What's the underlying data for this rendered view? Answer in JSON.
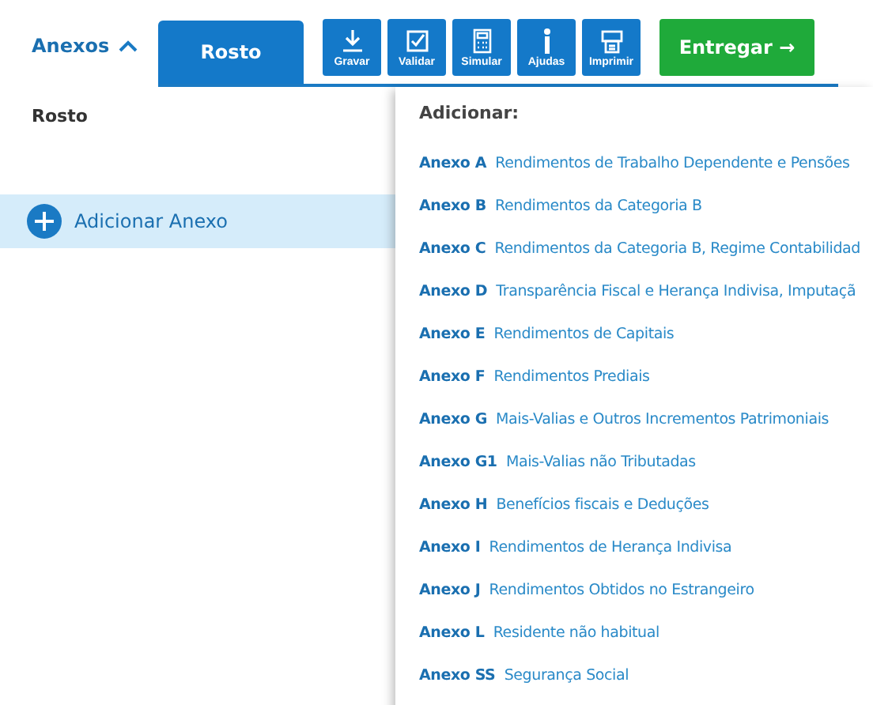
{
  "toolbar": {
    "menu": {
      "label": "Anexos",
      "expanded": true
    },
    "tab": {
      "label": "Rosto",
      "selected": true
    },
    "tools": [
      {
        "kind": "save",
        "label": "Gravar"
      },
      {
        "kind": "validate",
        "label": "Validar"
      },
      {
        "kind": "simulate",
        "label": "Simular"
      },
      {
        "kind": "help",
        "label": "Ajudas"
      },
      {
        "kind": "print",
        "label": "Imprimir"
      }
    ],
    "submit": {
      "label": "Entregar",
      "arrow": "→"
    }
  },
  "sidebar": {
    "items": [
      {
        "label": "Rosto",
        "kind": "page",
        "selected": false
      },
      {
        "label": "Adicionar Anexo",
        "kind": "add",
        "selected": true
      }
    ]
  },
  "dropdown": {
    "title": "Adicionar:",
    "items": [
      {
        "code": "Anexo A",
        "desc": "Rendimentos de Trabalho Dependente e Pensões"
      },
      {
        "code": "Anexo B",
        "desc": "Rendimentos da Categoria B"
      },
      {
        "code": "Anexo C",
        "desc": "Rendimentos da Categoria B, Regime Contabilidad"
      },
      {
        "code": "Anexo D",
        "desc": "Transparência Fiscal e Herança Indivisa, Imputaçã"
      },
      {
        "code": "Anexo E",
        "desc": "Rendimentos de Capitais"
      },
      {
        "code": "Anexo F",
        "desc": "Rendimentos Prediais"
      },
      {
        "code": "Anexo G",
        "desc": "Mais-Valias e Outros Incrementos Patrimoniais"
      },
      {
        "code": "Anexo G1",
        "desc": "Mais-Valias não Tributadas"
      },
      {
        "code": "Anexo H",
        "desc": "Benefícios fiscais e Deduções"
      },
      {
        "code": "Anexo I",
        "desc": "Rendimentos de Herança Indivisa"
      },
      {
        "code": "Anexo J",
        "desc": "Rendimentos Obtidos no Estrangeiro"
      },
      {
        "code": "Anexo L",
        "desc": "Residente não habitual"
      },
      {
        "code": "Anexo SS",
        "desc": "Segurança Social"
      }
    ]
  }
}
